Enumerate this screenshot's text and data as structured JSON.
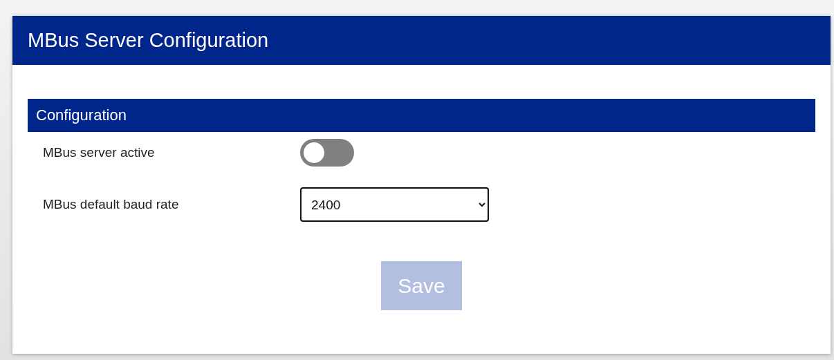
{
  "window": {
    "title": "MBus Server Configuration"
  },
  "section": {
    "title": "Configuration"
  },
  "fields": [
    {
      "kind": "toggle",
      "label": "MBus server active",
      "on": false
    },
    {
      "kind": "select",
      "label": "MBus default baud rate",
      "value": "2400"
    }
  ],
  "save_button": {
    "label": "Save",
    "disabled": true
  }
}
